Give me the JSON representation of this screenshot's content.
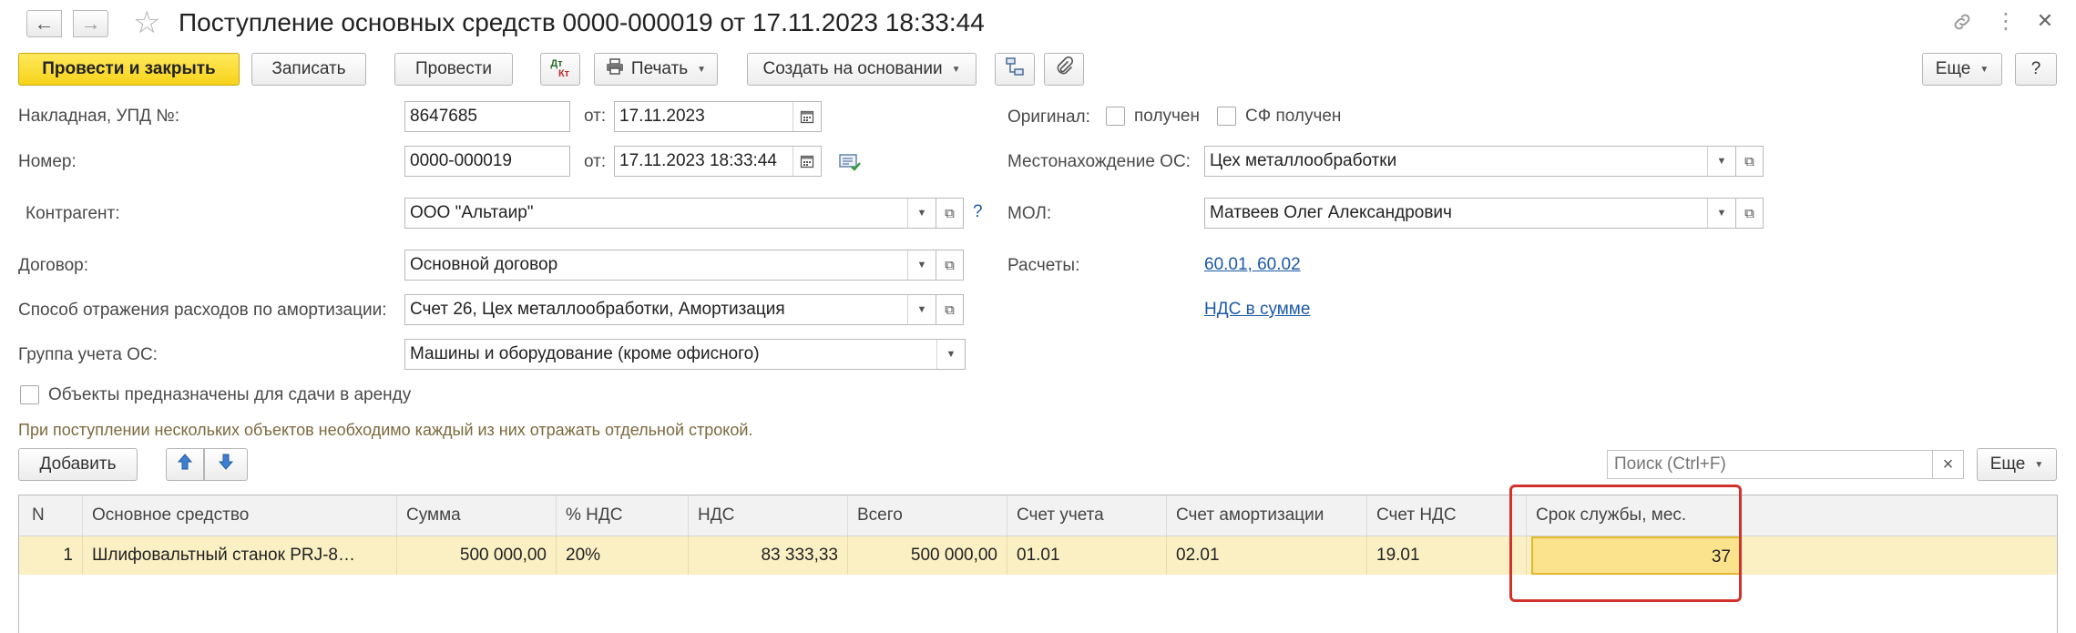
{
  "header": {
    "title": "Поступление основных средств 0000-000019 от 17.11.2023 18:33:44",
    "back_icon": "←",
    "forward_icon": "→",
    "favorite_icon": "☆",
    "link_icon": "🔗",
    "more_icon": "⋮",
    "close_icon": "✕"
  },
  "toolbar": {
    "post_close": "Провести и закрыть",
    "save": "Записать",
    "post": "Провести",
    "dtkt_top": "Дт",
    "dtkt_bottom": "Кт",
    "print": "Печать",
    "create_based": "Создать на основании",
    "more": "Еще",
    "help": "?"
  },
  "form": {
    "invoice_label": "Накладная, УПД №:",
    "invoice_value": "8647685",
    "from_label": "от:",
    "invoice_date": "17.11.2023",
    "number_label": "Номер:",
    "number_value": "0000-000019",
    "number_date": "17.11.2023 18:33:44",
    "original_label": "Оригинал:",
    "received_label": "получен",
    "sf_received_label": "СФ получен",
    "location_label": "Местонахождение ОС:",
    "location_value": "Цех металлообработки",
    "counterparty_label": "Контрагент:",
    "counterparty_value": "ООО \"Альтаир\"",
    "help_q": "?",
    "mol_label": "МОЛ:",
    "mol_value": "Матвеев Олег Александрович",
    "contract_label": "Договор:",
    "contract_value": "Основной договор",
    "settlements_label": "Расчеты:",
    "settlements_link": "60.01, 60.02",
    "depr_label": "Способ отражения расходов по амортизации:",
    "depr_value": "Счет 26, Цех металлообработки, Амортизация",
    "vat_link": "НДС в сумме",
    "group_label": "Группа учета ОС:",
    "group_value": "Машины и оборудование (кроме офисного)",
    "lease_label": "Объекты предназначены для сдачи в аренду",
    "hint": "При поступлении нескольких объектов необходимо каждый из них отражать отдельной строкой."
  },
  "table_toolbar": {
    "add": "Добавить",
    "search_placeholder": "Поиск (Ctrl+F)",
    "clear": "×",
    "more": "Еще"
  },
  "table": {
    "headers": [
      "N",
      "Основное средство",
      "Сумма",
      "% НДС",
      "НДС",
      "Всего",
      "Счет учета",
      "Счет амортизации",
      "Счет НДС",
      "Срок службы, мес."
    ],
    "rows": [
      [
        "1",
        "Шлифовальтный станок PRJ-8…",
        "500 000,00",
        "20%",
        "83 333,33",
        "500 000,00",
        "01.01",
        "02.01",
        "19.01",
        "37"
      ]
    ]
  },
  "colors": {
    "primary_button": "#f7d31a",
    "selected_row": "#fbf0c4",
    "highlight_frame": "#d2322d",
    "link": "#1c5aa6"
  }
}
